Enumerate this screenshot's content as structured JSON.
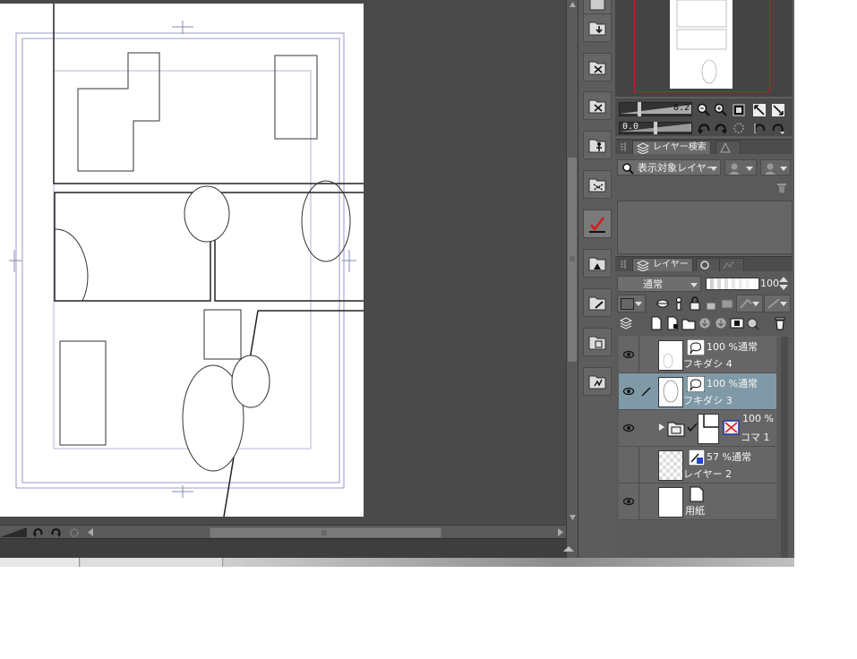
{
  "navigator": {
    "zoom_value": "8.2",
    "rotate_value": "0.0"
  },
  "layer_search_panel": {
    "tab_label": "レイヤー検索",
    "filter_dropdown": "表示対象レイヤー"
  },
  "layer_panel": {
    "tab_label": "レイヤー",
    "blend_mode": "通常",
    "opacity": "100",
    "layers": [
      {
        "opacity_mode": "100 %通常",
        "name": "フキダシ 4",
        "selected": false
      },
      {
        "opacity_mode": "100 %通常",
        "name": "フキダシ 3",
        "selected": true
      },
      {
        "opacity_mode": "100 %",
        "name": "コマ 1",
        "selected": false
      },
      {
        "opacity_mode": "57 %通常",
        "name": "レイヤー 2",
        "selected": false
      },
      {
        "opacity_mode": "",
        "name": "用紙",
        "selected": false
      }
    ]
  },
  "icons": [
    "folder-import-icon",
    "folder-delete-icon",
    "folder-delete-2-icon",
    "figure-icon",
    "selection-icon",
    "check-icon",
    "image-icon",
    "edit-icon",
    "3d-icon",
    "effects-icon",
    "eye-icon",
    "zoom-out-icon",
    "zoom-in-icon",
    "undo-icon",
    "redo-icon",
    "trash-icon"
  ],
  "colors": {
    "navigator_frame": "#c81e1e",
    "selected_layer": "#7f9aa6"
  }
}
